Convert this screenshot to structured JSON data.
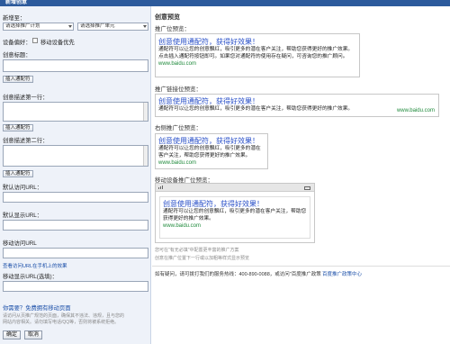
{
  "window": {
    "title": "新增创意"
  },
  "form": {
    "target_label": "新增至：",
    "plan_select": "请选择推广计划",
    "unit_select": "请选择推广单元",
    "device_label": "设备偏好：",
    "mobile_pref_label": "移动设备优先",
    "title_label": "创意标题：",
    "insert_wildcard": "插入通配符",
    "desc1_label": "创意描述第一行：",
    "desc2_label": "创意描述第二行：",
    "default_url_label": "默认访问URL：",
    "default_display_url_label": "默认显示URL：",
    "mobile_url_label": "移动访问URL",
    "mobile_url_note": "查看访问URL在手机上的效果",
    "mobile_display_url_label": "移动显示URL(选填)：",
    "tip_title": "你需要？免费拥有移动页面",
    "tip_text_1": "请访问从页推广规范的页面，确保其不违法、违规，且与您的",
    "tip_text_2": "网站内容相关。请勿填写电话/QQ等，否则将被系统拒绝。",
    "confirm_button": "确定",
    "cancel_button": "取消"
  },
  "preview": {
    "header": "创意预览",
    "top_label": "推广位预览：",
    "left_label": "推广链接位预览：",
    "right_label": "右侧推广位预览：",
    "mobile_label": "移动设备推广位预览：",
    "ad_title": "创意使用通配符，获得好效果！",
    "top_desc": "通配符可以让您的创意飘红，吸引更多的潜在客户关注，帮助您获得更好的推广效果。点击插入通配符按钮即可。如果您对通配符的使用存在疑问，可咨询您的推广顾问。",
    "left_desc": "通配符可以让您的创意飘红，吸引更多的潜在客户关注，帮助您获得更好的推广效果。",
    "right_desc": "通配符可以让您的创意飘红，吸引更多的潜在客户关注，帮助您获得更好的推广效果。",
    "mobile_desc": "通配符可以让您的创意飘红，吸引更多的潜在客户关注，帮助您获得更好的推广效果。",
    "url": "www.baidu.com",
    "note_1": "您可在\"有无必填\"中配置更丰富的推广方案",
    "note_2": "创意在推广位置下一行或以加粗等样式显示预览",
    "contact_text": "如有疑问，请可拨打我们的服务热线：400-890-0088，或访问\"百度推广政策中心\"。",
    "contact_link": "百度推广政策中心"
  },
  "colors": {
    "titlebar": "#2c5a9c",
    "left_panel": "#eef2f9",
    "ad_title": "#2a50c8",
    "ad_url": "#1f8a3b",
    "link": "#1a4ea8"
  }
}
